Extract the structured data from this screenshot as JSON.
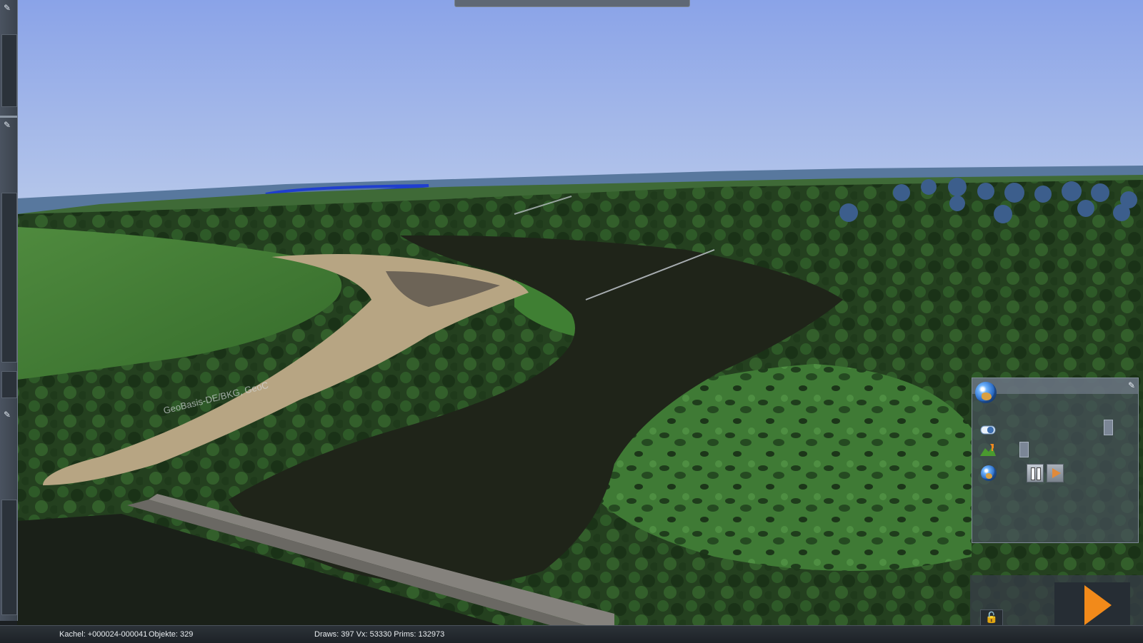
{
  "status_bar": {
    "tile": "Kachel: +000024-000041",
    "objects": "Objekte: 329",
    "render_stats": "Draws: 397 Vx: 53330 Prims: 132973"
  },
  "terrain": {
    "watermark": "GeoBasis-DE/BKG, GeoC"
  },
  "control_panel": {
    "pin_icon": "pin-icon",
    "icons": [
      "globe-icon",
      "clouds-icon",
      "terrain-icon",
      "world-icon",
      "pause-icon",
      "play-icon"
    ]
  },
  "bottom_controls": {
    "lock_icon": "unlock-icon",
    "play_icon": "play-icon"
  },
  "colors": {
    "accent_play": "#f28a1a",
    "sky_top": "#8aa5e6",
    "sky_horizon": "#b8c9ea",
    "water": "#1f2419"
  }
}
